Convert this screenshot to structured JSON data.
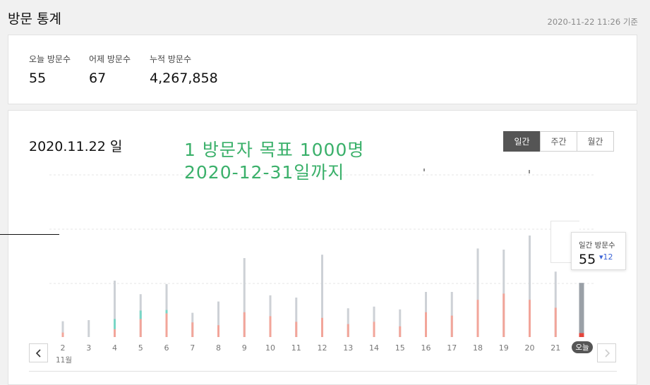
{
  "header": {
    "title": "방문 통계",
    "timestamp": "2020-11-22 11:26 기준"
  },
  "stats": {
    "today_label": "오늘 방문수",
    "today_value": "55",
    "yesterday_label": "어제 방문수",
    "yesterday_value": "67",
    "total_label": "누적 방문수",
    "total_value": "4,267,858"
  },
  "chart_panel": {
    "date_title": "2020.11.22 일",
    "goal_text": "1 방문자 목표 1000명\n2020-12-31일까지",
    "tabs": [
      {
        "label": "일간",
        "active": true
      },
      {
        "label": "주간",
        "active": false
      },
      {
        "label": "월간",
        "active": false
      }
    ],
    "month_label": "11월",
    "today_badge": "오늘",
    "tooltip": {
      "label": "일간 방문수",
      "value": "55",
      "delta": "▾12"
    }
  },
  "colors": {
    "total_bar": "#cdd1d6",
    "new_bar": "#f2a59a",
    "teal_bar": "#79d6c6",
    "today_bar": "#9aa0a7",
    "today_marker": "#e5463c",
    "goal_text": "#3ab06a",
    "delta": "#3a62d6"
  },
  "chart_data": {
    "type": "bar",
    "categories": [
      "2",
      "3",
      "4",
      "5",
      "6",
      "7",
      "8",
      "9",
      "10",
      "11",
      "12",
      "13",
      "14",
      "15",
      "16",
      "17",
      "18",
      "19",
      "20",
      "21",
      "오늘"
    ],
    "series": [
      {
        "values": [
          28,
          30,
          100,
          76,
          94,
          43,
          63,
          140,
          74,
          70,
          146,
          51,
          54,
          49,
          80,
          80,
          157,
          155,
          180,
          116,
          96
        ]
      },
      {
        "values": [
          8,
          0,
          14,
          32,
          42,
          26,
          21,
          44,
          37,
          27,
          34,
          23,
          27,
          19,
          44,
          38,
          66,
          77,
          66,
          52,
          7
        ]
      },
      {
        "values": [
          0,
          0,
          18,
          15,
          6,
          0,
          0,
          0,
          0,
          0,
          0,
          0,
          0,
          0,
          0,
          0,
          0,
          0,
          0,
          0,
          0
        ]
      }
    ],
    "ylim": [
      0,
      195
    ],
    "grid": true,
    "highlight_index": 20
  }
}
